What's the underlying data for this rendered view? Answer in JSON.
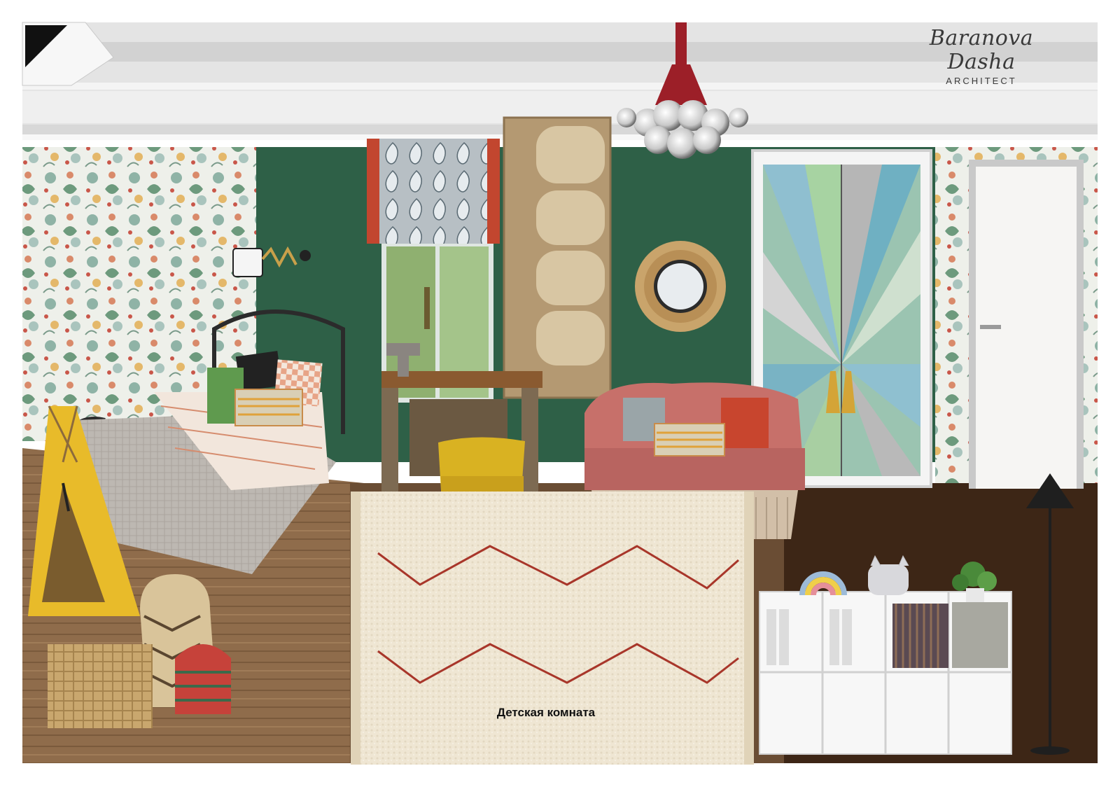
{
  "brand": {
    "name": "Baranova Dasha",
    "subtitle": "ARCHITECT"
  },
  "caption": "Детская комната",
  "colors": {
    "wall_green": "#2e6047",
    "ceiling": "#dcdcdc",
    "floor_wood": "#8a6a4a",
    "floor_dark": "#3d2616",
    "sofa_pink": "#c7706a",
    "chair_yellow": "#d9b222",
    "teepee_yellow": "#e8bb2a",
    "rug_cream": "#eee4d0",
    "rug_zigzag": "#a8362a",
    "pendant_red": "#9c1f28"
  },
  "objects": [
    "ceiling-molding",
    "floral-wallpaper",
    "green-wall",
    "paisley-blind",
    "window",
    "wooden-bookshelf",
    "pendant-chandelier",
    "rattan-mirror",
    "painted-wardrobe",
    "white-door",
    "wall-sconce",
    "iron-bed",
    "cushions",
    "teepee-tent",
    "woven-baskets",
    "desk",
    "table-lamp",
    "yellow-chair",
    "pink-sofa",
    "side-table",
    "berber-rug",
    "white-cube-shelf",
    "rainbow-toy",
    "cat-plush",
    "potted-plant",
    "floor-lamp"
  ]
}
